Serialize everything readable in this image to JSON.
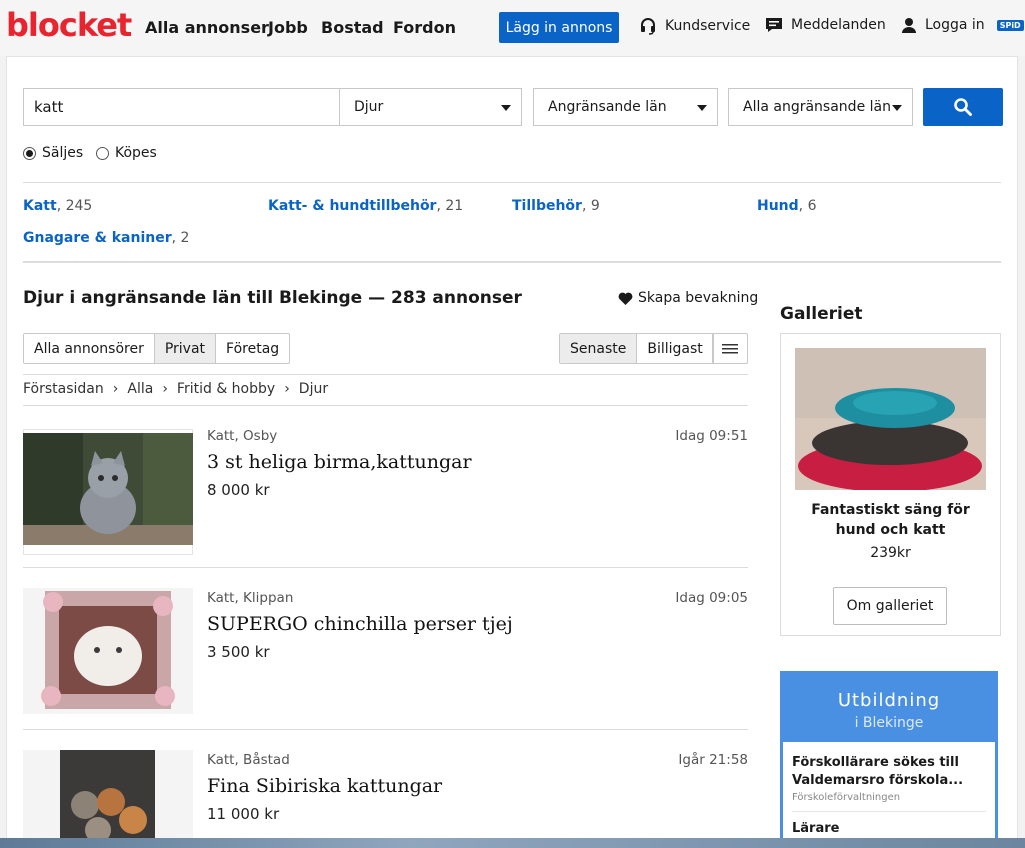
{
  "header": {
    "logo": "blocket",
    "nav": [
      "Alla annonser",
      "Jobb",
      "Bostad",
      "Fordon"
    ],
    "post_button": "Lägg in annons",
    "customer_service": "Kundservice",
    "messages": "Meddelanden",
    "login": "Logga in",
    "spid": "SPiD"
  },
  "search": {
    "query": "katt",
    "category": "Djur",
    "region": "Angränsande län",
    "subregion": "Alla angränsande län",
    "radio": {
      "sell": "Säljes",
      "buy": "Köpes",
      "selected": "Säljes"
    }
  },
  "categories": [
    {
      "name": "Katt",
      "count": ", 245"
    },
    {
      "name": "Katt- & hundtillbehör",
      "count": ", 21"
    },
    {
      "name": "Tillbehör",
      "count": ", 9"
    },
    {
      "name": "Hund",
      "count": ", 6"
    },
    {
      "name": "Gnagare & kaniner",
      "count": ", 2"
    }
  ],
  "results": {
    "heading": "Djur i angränsande län till Blekinge — 283 annonser",
    "watch": "Skapa bevakning",
    "filters": [
      "Alla annonsörer",
      "Privat",
      "Företag"
    ],
    "filter_selected": "Privat",
    "sort": [
      "Senaste",
      "Billigast"
    ],
    "sort_selected": "Senaste",
    "breadcrumb": [
      "Förstasidan",
      "›",
      "Alla",
      "›",
      "Fritid & hobby",
      "›",
      "Djur"
    ]
  },
  "listings": [
    {
      "meta": "Katt, Osby",
      "time": "Idag 09:51",
      "title": "3 st heliga birma,kattungar",
      "price": "8 000 kr"
    },
    {
      "meta": "Katt, Klippan",
      "time": "Idag 09:05",
      "title": "SUPERGO chinchilla perser tjej",
      "price": "3 500 kr"
    },
    {
      "meta": "Katt, Båstad",
      "time": "Igår 21:58",
      "title": "Fina Sibiriska kattungar",
      "price": "11 000 kr"
    }
  ],
  "gallery": {
    "title": "Galleriet",
    "item_name": "Fantastiskt säng för hund och katt",
    "item_price": "239kr",
    "button": "Om galleriet"
  },
  "education": {
    "title": "Utbildning",
    "subtitle": "i Blekinge",
    "jobs": [
      {
        "title": "Förskollärare sökes till Valdemarsro förskola...",
        "org": "Förskoleförvaltningen"
      },
      {
        "title": "Lärare",
        "org": ""
      }
    ]
  },
  "colors": {
    "brand_red": "#e8242f",
    "accent_blue": "#0a63c7",
    "edu_blue": "#4a90e2"
  }
}
